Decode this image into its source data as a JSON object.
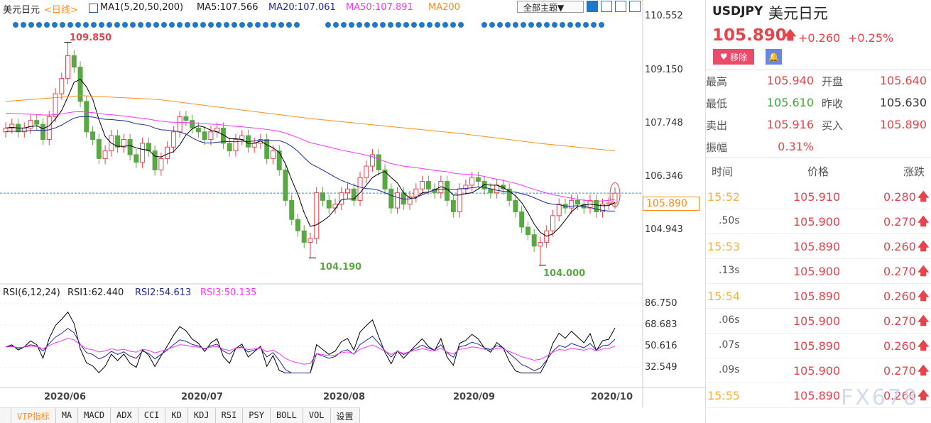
{
  "header": {
    "symbol_cn": "美元日元",
    "period": "<日线>",
    "ma_label": "MA1(5,20,50,200)",
    "ma5": "MA5:107.566",
    "ma20": "MA20:107.061",
    "ma50": "MA50:107.891",
    "ma200": "MA200",
    "theme_btn": "全部主题▼"
  },
  "rsi_header": {
    "name": "RSI(6,12,24)",
    "rsi1": "RSI1:62.440",
    "rsi2": "RSI2:54.613",
    "rsi3": "RSI3:50.135"
  },
  "colors": {
    "up": "#e8424b",
    "down": "#5aa843",
    "ma5": "#000000",
    "ma20": "#1e2a9c",
    "ma50": "#ff33ff",
    "ma200": "#ff8c1a"
  },
  "chart_data": {
    "type": "candlestick",
    "price_ticks": [
      "110.552",
      "109.150",
      "107.748",
      "106.346",
      "104.943"
    ],
    "price_range": [
      104.943,
      110.552
    ],
    "current_price": "105.890",
    "annotations": {
      "high": "109.850",
      "low1": "104.190",
      "low2": "104.000"
    },
    "date_ticks": [
      "2020/06",
      "2020/07",
      "2020/08",
      "2020/09",
      "2020/10"
    ],
    "closes": [
      107.6,
      107.7,
      107.5,
      107.6,
      107.8,
      107.7,
      107.3,
      107.9,
      108.5,
      108.9,
      109.5,
      109.2,
      108.3,
      107.5,
      107.3,
      106.8,
      107.0,
      107.4,
      107.1,
      107.3,
      106.9,
      106.7,
      107.2,
      107.0,
      106.5,
      106.8,
      107.1,
      107.5,
      107.9,
      107.8,
      107.6,
      107.5,
      107.3,
      107.5,
      107.6,
      107.2,
      107.0,
      107.3,
      107.4,
      107.1,
      107.2,
      107.3,
      106.8,
      107.0,
      106.5,
      105.7,
      105.2,
      104.9,
      104.6,
      104.7,
      105.9,
      105.7,
      105.5,
      105.6,
      105.9,
      106.0,
      105.7,
      106.3,
      106.6,
      106.9,
      106.5,
      106.0,
      105.5,
      105.9,
      105.6,
      105.8,
      106.0,
      106.2,
      106.0,
      105.9,
      106.2,
      105.7,
      105.4,
      106.0,
      106.1,
      106.3,
      106.2,
      106.0,
      105.9,
      106.1,
      106.0,
      105.7,
      105.4,
      105.0,
      104.8,
      104.5,
      104.6,
      104.9,
      105.3,
      105.6,
      105.5,
      105.7,
      105.6,
      105.5,
      105.7,
      105.4,
      105.6,
      105.63,
      105.89
    ],
    "ma200": [
      108.3,
      108.45,
      108.35,
      108.1,
      107.85,
      107.65,
      107.45,
      107.2,
      107.0
    ],
    "rsi_ticks": [
      "86.750",
      "68.683",
      "50.616",
      "32.549"
    ],
    "rsi_range": [
      32.549,
      86.75
    ]
  },
  "tabs": [
    "VIP指标",
    "MA",
    "MACD",
    "ADX",
    "CCI",
    "KD",
    "KDJ",
    "RSI",
    "PSY",
    "BOLL",
    "VOL",
    "设置"
  ],
  "quote": {
    "symbol": "USDJPY",
    "name": "美元日元",
    "price": "105.890",
    "change": "+0.260",
    "pct": "+0.25%",
    "remove": "移除",
    "stats": [
      {
        "l": "最高",
        "v": "105.940",
        "l2": "开盘",
        "v2": "105.640"
      },
      {
        "l": "最低",
        "v": "105.610",
        "l2": "昨收",
        "v2": "105.630"
      },
      {
        "l": "卖出",
        "v": "105.916",
        "l2": "买入",
        "v2": "105.890"
      },
      {
        "l": "振幅",
        "v": "0.31%"
      }
    ],
    "cols": [
      "时间",
      "价格",
      "涨跌"
    ],
    "ticks": [
      {
        "t": "15:52",
        "p": "105.910",
        "c": "0.280"
      },
      {
        "t": ".50s",
        "p": "105.900",
        "c": "0.270"
      },
      {
        "t": "15:53",
        "p": "105.890",
        "c": "0.260"
      },
      {
        "t": ".13s",
        "p": "105.900",
        "c": "0.270"
      },
      {
        "t": "15:54",
        "p": "105.890",
        "c": "0.260"
      },
      {
        "t": ".06s",
        "p": "105.900",
        "c": "0.270"
      },
      {
        "t": ".07s",
        "p": "105.890",
        "c": "0.260"
      },
      {
        "t": ".09s",
        "p": "105.900",
        "c": "0.270"
      },
      {
        "t": "15:55",
        "p": "105.890",
        "c": "0.260"
      }
    ]
  },
  "watermark": "FX678"
}
